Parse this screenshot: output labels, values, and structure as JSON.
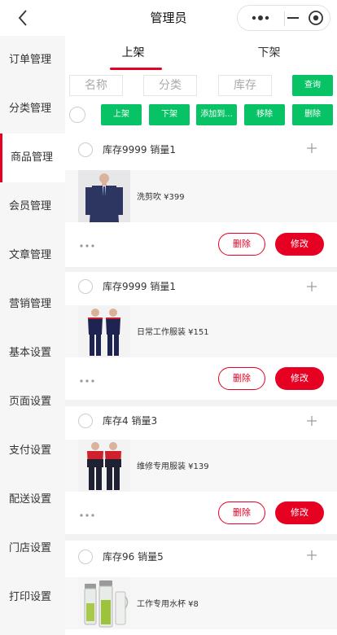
{
  "header": {
    "title": "管理员"
  },
  "sidebar": {
    "items": [
      {
        "label": "订单管理"
      },
      {
        "label": "分类管理"
      },
      {
        "label": "商品管理"
      },
      {
        "label": "会员管理"
      },
      {
        "label": "文章管理"
      },
      {
        "label": "营销管理"
      },
      {
        "label": "基本设置"
      },
      {
        "label": "页面设置"
      },
      {
        "label": "支付设置"
      },
      {
        "label": "配送设置"
      },
      {
        "label": "门店设置"
      },
      {
        "label": "打印设置"
      }
    ],
    "active": "商品管理"
  },
  "tabs": [
    {
      "label": "上架"
    },
    {
      "label": "下架"
    }
  ],
  "filter": {
    "name_placeholder": "名称",
    "category_placeholder": "分类",
    "stock_placeholder": "库存",
    "query_label": "查询"
  },
  "actions": {
    "shelve": "上架",
    "unshelve": "下架",
    "add_to": "添加到...",
    "remove": "移除",
    "delete": "删除"
  },
  "products": [
    {
      "stock_sales": "库存9999 销量1",
      "name_price": "洗剪吹 ¥399",
      "delete_label": "删除",
      "edit_label": "修改"
    },
    {
      "stock_sales": "库存9999 销量1",
      "name_price": "日常工作服装 ¥151",
      "delete_label": "删除",
      "edit_label": "修改"
    },
    {
      "stock_sales": "库存4 销量3",
      "name_price": "维修专用服装 ¥139",
      "delete_label": "删除",
      "edit_label": "修改"
    },
    {
      "stock_sales": "库存96 销量5",
      "name_price": "工作专用水杯 ¥8"
    }
  ],
  "colors": {
    "accent": "#e60022",
    "green": "#08c365"
  }
}
